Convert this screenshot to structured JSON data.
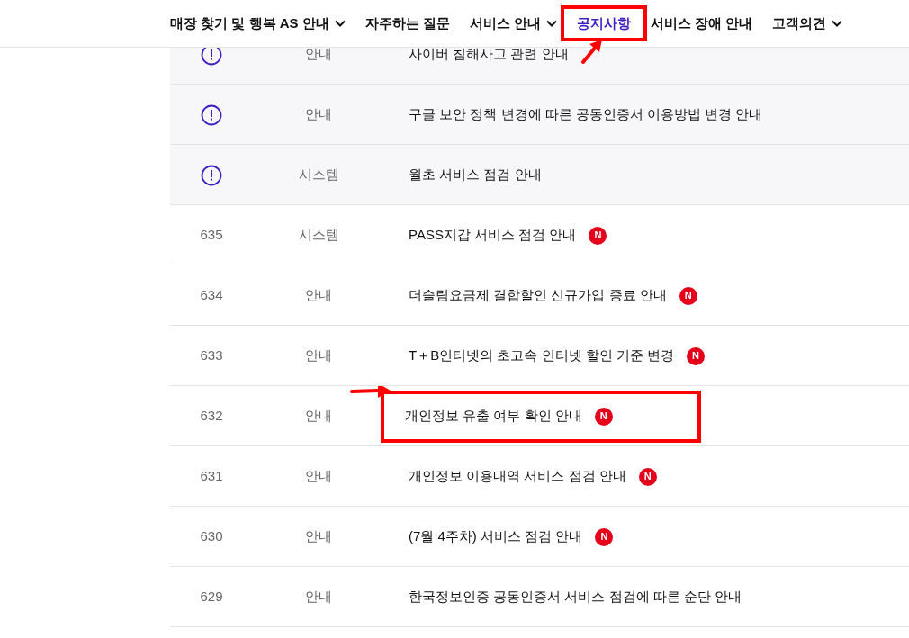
{
  "nav": [
    {
      "label": "매장 찾기 및 행복 AS 안내",
      "dropdown": true,
      "selected": false,
      "highlighted": false
    },
    {
      "label": "자주하는 질문",
      "dropdown": false,
      "selected": false,
      "highlighted": false
    },
    {
      "label": "서비스 안내",
      "dropdown": true,
      "selected": false,
      "highlighted": false
    },
    {
      "label": "공지사항",
      "dropdown": false,
      "selected": true,
      "highlighted": true
    },
    {
      "label": "서비스 장애 안내",
      "dropdown": false,
      "selected": false,
      "highlighted": false
    },
    {
      "label": "고객의견",
      "dropdown": true,
      "selected": false,
      "highlighted": false
    }
  ],
  "notices": [
    {
      "kind": "pinned",
      "category": "안내",
      "title": "사이버 침해사고 관련 안내",
      "new": false,
      "highlighted": false
    },
    {
      "kind": "pinned",
      "category": "안내",
      "title": "구글 보안 정책 변경에 따른 공동인증서 이용방법 변경 안내",
      "new": false,
      "highlighted": false
    },
    {
      "kind": "pinned",
      "category": "시스템",
      "title": "월초 서비스 점검 안내",
      "new": false,
      "highlighted": false
    },
    {
      "kind": "numbered",
      "number": "635",
      "category": "시스템",
      "title": "PASS지갑 서비스 점검 안내",
      "new": true,
      "badge": "N",
      "highlighted": false
    },
    {
      "kind": "numbered",
      "number": "634",
      "category": "안내",
      "title": "더슬림요금제 결합할인 신규가입 종료 안내",
      "new": true,
      "badge": "N",
      "highlighted": false
    },
    {
      "kind": "numbered",
      "number": "633",
      "category": "안내",
      "title": "T＋B인터넷의 초고속 인터넷 할인 기준 변경",
      "new": true,
      "badge": "N",
      "highlighted": false
    },
    {
      "kind": "numbered",
      "number": "632",
      "category": "안내",
      "title": "개인정보 유출 여부 확인 안내",
      "new": true,
      "badge": "N",
      "highlighted": true
    },
    {
      "kind": "numbered",
      "number": "631",
      "category": "안내",
      "title": "개인정보 이용내역 서비스 점검 안내",
      "new": true,
      "badge": "N",
      "highlighted": false
    },
    {
      "kind": "numbered",
      "number": "630",
      "category": "안내",
      "title": "(7월 4주차) 서비스 점검 안내",
      "new": true,
      "badge": "N",
      "highlighted": false
    },
    {
      "kind": "numbered",
      "number": "629",
      "category": "안내",
      "title": "한국정보인증 공동인증서 서비스 점검에 따른 순단 안내",
      "new": false,
      "highlighted": false
    }
  ]
}
